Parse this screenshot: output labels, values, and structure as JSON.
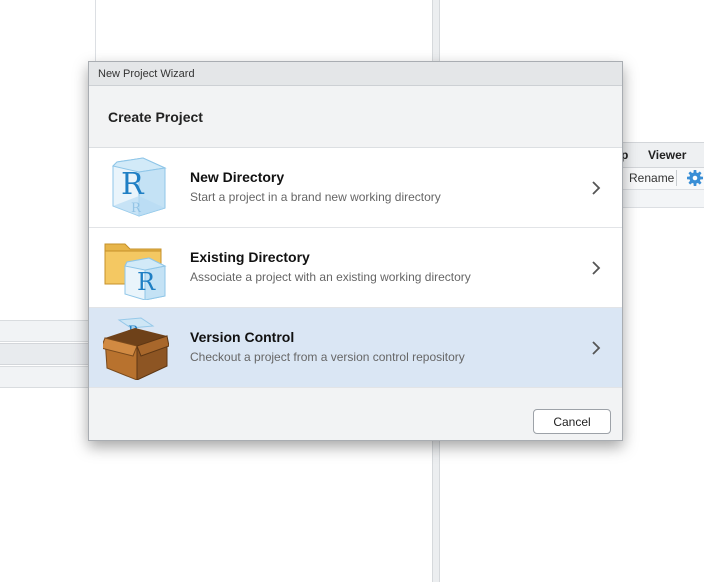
{
  "background": {
    "tabs": [
      "p",
      "Viewer"
    ],
    "toolbar": {
      "rename_label": "Rename"
    }
  },
  "dialog": {
    "title": "New Project Wizard",
    "header": "Create Project",
    "options": [
      {
        "title": "New Directory",
        "description": "Start a project in a brand new working directory",
        "icon": "r-cube-icon"
      },
      {
        "title": "Existing Directory",
        "description": "Associate a project with an existing working directory",
        "icon": "folder-r-icon"
      },
      {
        "title": "Version Control",
        "description": "Checkout a project from a version control repository",
        "icon": "cardboard-box-icon"
      }
    ],
    "selected_option": "Version Control",
    "cancel_label": "Cancel"
  },
  "colors": {
    "selected_row": "#dae6f4",
    "gear": "#3a8fd6"
  }
}
